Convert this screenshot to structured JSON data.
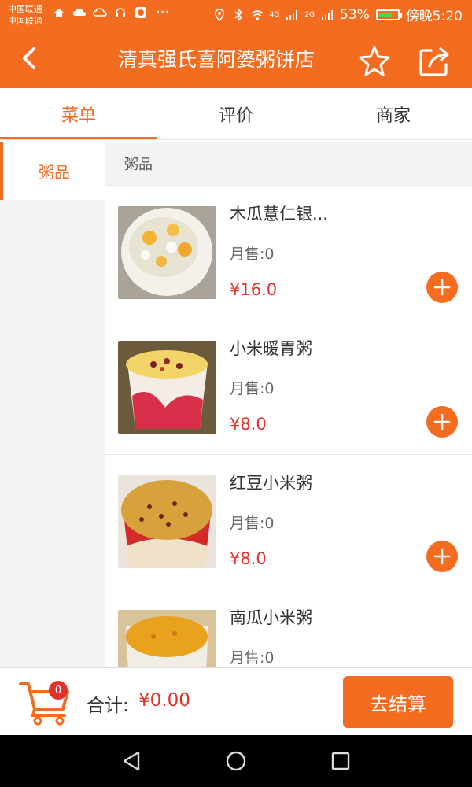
{
  "status_bar": {
    "carrier_1": "中国联通",
    "carrier_2": "中国联通",
    "signal_1": "4G",
    "signal_2": "2G",
    "battery": "53%",
    "time": "傍晚5:20",
    "more": "···"
  },
  "header": {
    "title": "清真强氏喜阿婆粥饼店",
    "icons": [
      "back-chevron-icon",
      "star-icon",
      "share-icon"
    ]
  },
  "tabs": [
    {
      "label": "菜单",
      "active": true
    },
    {
      "label": "评价",
      "active": false
    },
    {
      "label": "商家",
      "active": false
    }
  ],
  "sidebar": {
    "categories": [
      {
        "label": "粥品",
        "active": true
      }
    ]
  },
  "section": {
    "title": "粥品"
  },
  "products": [
    {
      "name": "木瓜薏仁银...",
      "sold": "月售:0",
      "price": "¥16.0"
    },
    {
      "name": "小米暖胃粥",
      "sold": "月售:0",
      "price": "¥8.0"
    },
    {
      "name": "红豆小米粥",
      "sold": "月售:0",
      "price": "¥8.0"
    },
    {
      "name": "南瓜小米粥",
      "sold": "月售:0",
      "price": ""
    }
  ],
  "cart": {
    "count": "0",
    "total_label": "合计:",
    "total_value": "¥0.00",
    "checkout_label": "去结算"
  },
  "colors": {
    "accent": "#f46c1f",
    "price": "#e0312b",
    "badge": "#e0312b"
  }
}
